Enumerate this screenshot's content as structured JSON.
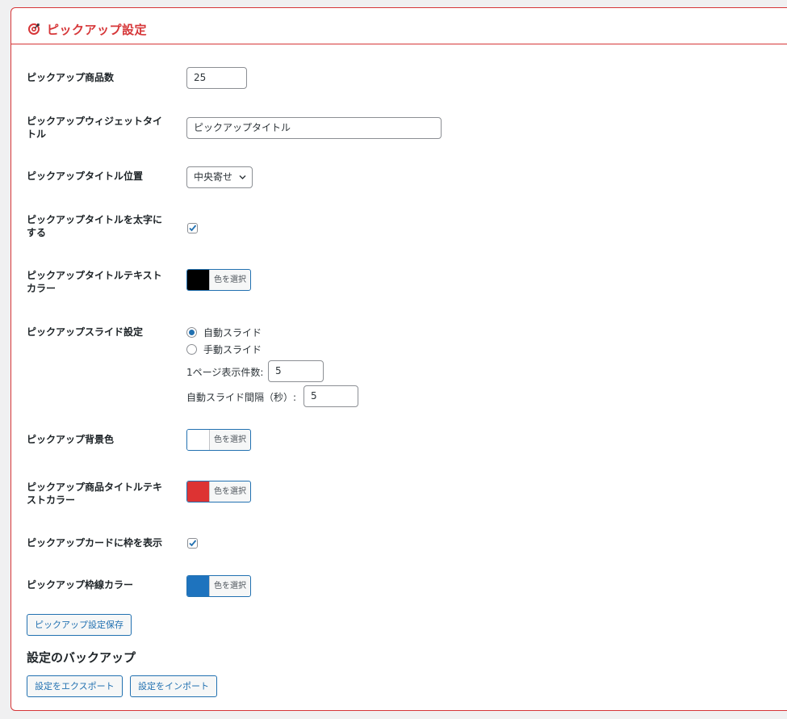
{
  "panel": {
    "title": "ピックアップ設定",
    "icon": "target-icon"
  },
  "settings": {
    "count": {
      "label": "ピックアップ商品数",
      "value": "25"
    },
    "widget_title": {
      "label_line1": "ピックアップウィジェットタイ",
      "label_line2": "トル",
      "value": "ピックアップタイトル"
    },
    "title_position": {
      "label": "ピックアップタイトル位置",
      "selected": "中央寄せ"
    },
    "title_bold": {
      "label_line1": "ピックアップタイトルを太字に",
      "label_line2": "する",
      "checked": true
    },
    "title_text_color": {
      "label_line1": "ピックアップタイトルテキスト",
      "label_line2": "カラー",
      "button": "色を選択",
      "color": "#000000"
    },
    "slide": {
      "label": "ピックアップスライド設定",
      "options": [
        "自動スライド",
        "手動スライド"
      ],
      "selected": "自動スライド",
      "per_page_label": "1ページ表示件数:",
      "per_page_value": "5",
      "interval_label": "自動スライド間隔（秒）:",
      "interval_value": "5"
    },
    "bg_color": {
      "label": "ピックアップ背景色",
      "button": "色を選択",
      "color": "#ffffff"
    },
    "product_title_color": {
      "label_line1": "ピックアップ商品タイトルテキ",
      "label_line2": "ストカラー",
      "button": "色を選択",
      "color": "#dd3333"
    },
    "card_border": {
      "label": "ピックアップカードに枠を表示",
      "checked": true
    },
    "border_color": {
      "label": "ピックアップ枠線カラー",
      "button": "色を選択",
      "color": "#1e73be"
    }
  },
  "save_button": "ピックアップ設定保存",
  "backup": {
    "title": "設定のバックアップ",
    "export_button": "設定をエクスポート",
    "import_button": "設定をインポート"
  },
  "colors": {
    "accent": "#d63638",
    "link": "#2271b1"
  }
}
